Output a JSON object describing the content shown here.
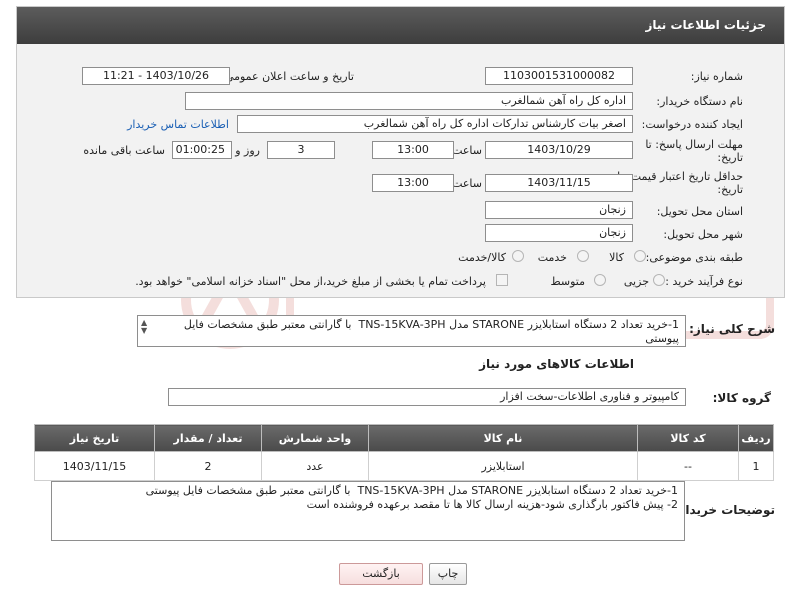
{
  "panel": {
    "title": "جزئیات اطلاعات نیاز"
  },
  "fields": {
    "need_number_label": "شماره نیاز:",
    "need_number": "1103001531000082",
    "announce_label": "تاریخ و ساعت اعلان عمومی:",
    "announce_value": "1403/10/26 - 11:21",
    "buyer_org_label": "نام دستگاه خریدار:",
    "buyer_org": "اداره کل راه آهن شمالغرب",
    "creator_label": "ایجاد کننده درخواست:",
    "creator": "اصغر بیات کارشناس تدارکات اداره کل راه آهن شمالغرب",
    "contact_link": "اطلاعات تماس خریدار",
    "reply_deadline_label_1": "مهلت ارسال پاسخ: تا",
    "reply_deadline_label_2": "تاریخ:",
    "reply_date": "1403/10/29",
    "time_label": "ساعت",
    "reply_time": "13:00",
    "days_value": "3",
    "days_label": "روز و",
    "remaining_time": "01:00:25",
    "remaining_label": "ساعت باقی مانده",
    "validity_label_1": "حداقل تاریخ اعتبار قیمت: تا",
    "validity_label_2": "تاریخ:",
    "validity_date": "1403/11/15",
    "validity_time": "13:00",
    "province_label": "استان محل تحویل:",
    "province": "زنجان",
    "city_label": "شهر محل تحویل:",
    "city": "زنجان",
    "category_label": "طبقه بندی موضوعی:",
    "category_options": [
      "کالا",
      "خدمت",
      "کالا/خدمت"
    ],
    "process_label": "نوع فرآیند خرید :",
    "process_options": [
      "جزیی",
      "متوسط"
    ],
    "payment_note": "پرداخت تمام یا بخشی از مبلغ خرید،از محل \"اسناد خزانه اسلامی\" خواهد بود."
  },
  "summary": {
    "label": "شرح کلی نیاز:",
    "text": "1-خرید تعداد 2 دستگاه استابلایزر STARONE مدل TNS-15KVA-3PH  با گارانتی معتبر طبق مشخصات فایل پیوستی"
  },
  "goods_info_title": "اطلاعات کالاهای مورد نیاز",
  "goods_group": {
    "label": "گروه کالا:",
    "value": "کامپیوتر و فناوری اطلاعات-سخت افزار"
  },
  "table": {
    "headers": [
      "ردیف",
      "کد کالا",
      "نام کالا",
      "واحد شمارش",
      "تعداد / مقدار",
      "تاریخ نیاز"
    ],
    "rows": [
      [
        "1",
        "--",
        "استابلایزر",
        "عدد",
        "2",
        "1403/11/15"
      ]
    ]
  },
  "buyer_notes": {
    "label": "توضیحات خریدار:",
    "text": "1-خرید تعداد 2 دستگاه استابلایزر STARONE مدل TNS-15KVA-3PH  با گارانتی معتبر طبق مشخصات فایل پیوستی\n2- پیش فاکتور بارگذاری شود-هزینه ارسال کالا ها تا مقصد برعهده فروشنده است"
  },
  "buttons": {
    "print": "چاپ",
    "back": "بازگشت"
  },
  "colors": {
    "header_bg": "#4a4a4a",
    "link": "#1a5fb4",
    "panel_bg": "#f2f2f2"
  }
}
